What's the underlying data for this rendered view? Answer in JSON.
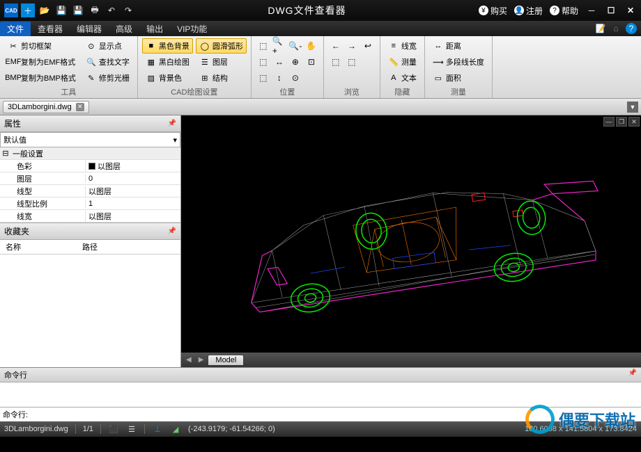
{
  "titlebar": {
    "title": "DWG文件查看器",
    "buy": "购买",
    "register": "注册",
    "help": "帮助"
  },
  "menu": {
    "tabs": [
      "文件",
      "查看器",
      "编辑器",
      "高级",
      "输出",
      "VIP功能"
    ],
    "active": 0
  },
  "ribbon": {
    "groups": [
      {
        "label": "工具",
        "cols": [
          [
            {
              "icon": "✂",
              "text": "剪切框架"
            },
            {
              "icon": "EMF",
              "text": "复制为EMF格式"
            },
            {
              "icon": "BMP",
              "text": "复制为BMP格式"
            }
          ],
          [
            {
              "icon": "⊙",
              "text": "显示点"
            },
            {
              "icon": "🔍",
              "text": "查找文字"
            },
            {
              "icon": "✎",
              "text": "修剪光栅"
            }
          ]
        ]
      },
      {
        "label": "CAD绘图设置",
        "cols": [
          [
            {
              "icon": "■",
              "text": "黑色背景",
              "hl": true
            },
            {
              "icon": "▦",
              "text": "黑白绘图"
            },
            {
              "icon": "▨",
              "text": "背景色"
            }
          ],
          [
            {
              "icon": "◯",
              "text": "圆滑弧形",
              "hl": true
            },
            {
              "icon": "☰",
              "text": "图层"
            },
            {
              "icon": "⊞",
              "text": "结构"
            }
          ]
        ]
      },
      {
        "label": "位置",
        "iconGrid": [
          [
            "⬚",
            "🔍+",
            "🔍-",
            "✋"
          ],
          [
            "⬚",
            "↔",
            "⊕",
            "⊡"
          ],
          [
            "⬚",
            "↕",
            "⊙",
            ""
          ]
        ]
      },
      {
        "label": "浏览",
        "iconGrid": [
          [
            "←",
            "→",
            "↩"
          ],
          [
            "⬚",
            "⬚",
            ""
          ]
        ]
      },
      {
        "label": "隐藏",
        "cols": [
          [
            {
              "icon": "≡",
              "text": "线宽"
            },
            {
              "icon": "📏",
              "text": "测量"
            },
            {
              "icon": "A",
              "text": "文本"
            }
          ]
        ]
      },
      {
        "label": "测量",
        "cols": [
          [
            {
              "icon": "↔",
              "text": "距离"
            },
            {
              "icon": "⟿",
              "text": "多段线长度"
            },
            {
              "icon": "▭",
              "text": "面积"
            }
          ]
        ]
      }
    ]
  },
  "doctab": {
    "name": "3DLamborgini.dwg"
  },
  "props": {
    "title": "属性",
    "combo": "默认值",
    "section": "一般设置",
    "rows": [
      {
        "name": "色彩",
        "val": "以图层",
        "swatch": true
      },
      {
        "name": "图层",
        "val": "0"
      },
      {
        "name": "线型",
        "val": "以图层"
      },
      {
        "name": "线型比例",
        "val": "1"
      },
      {
        "name": "线宽",
        "val": "以图层"
      }
    ]
  },
  "fav": {
    "title": "收藏夹",
    "col1": "名称",
    "col2": "路径"
  },
  "modeltab": "Model",
  "cmd": {
    "title": "命令行",
    "prompt": "命令行:"
  },
  "status": {
    "file": "3DLamborgini.dwg",
    "page": "1/1",
    "coords": "(-243.9179; -61.54266; 0)",
    "dims": "180.6008 x 141.5804 x 173.8424"
  },
  "watermark": "偶要下载站"
}
